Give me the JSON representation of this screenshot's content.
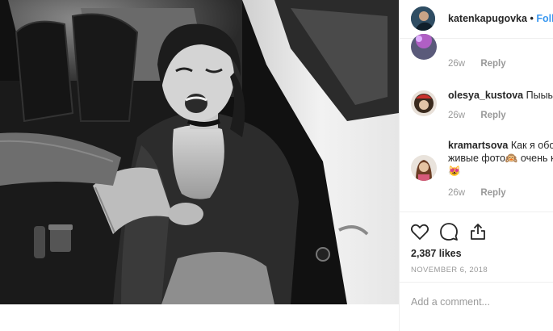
{
  "post": {
    "username": "katenkapugovka",
    "separator": "•",
    "follow_label": "Follo"
  },
  "comments": [
    {
      "username": "",
      "text": "",
      "age": "26w",
      "reply_label": "Reply"
    },
    {
      "username": "olesya_kustova",
      "text": "Пыыыы",
      "age": "26w",
      "reply_label": "Reply"
    },
    {
      "username": "kramartsova",
      "text": "Как я обо",
      "text_line2": "живые фото🙉 очень к",
      "text_line3": "😻",
      "age": "26w",
      "reply_label": "Reply"
    }
  ],
  "engagement": {
    "likes": "2,387 likes",
    "date": "NOVEMBER 6, 2018"
  },
  "add_comment": {
    "placeholder": "Add a comment..."
  },
  "icons": [
    "heart-icon",
    "comment-icon",
    "share-icon"
  ],
  "colors": {
    "link": "#3897f0",
    "text": "#262626",
    "muted": "#999999",
    "border": "#efefef"
  }
}
